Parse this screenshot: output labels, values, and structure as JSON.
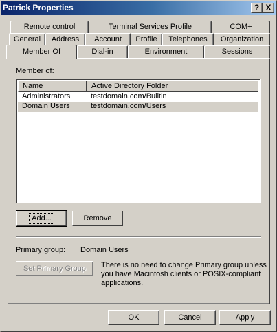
{
  "window": {
    "title": "Patrick Properties",
    "help_button": "?",
    "close_button": "X"
  },
  "tabs": {
    "row1": [
      "Remote control",
      "Terminal Services Profile",
      "COM+"
    ],
    "row2": [
      "General",
      "Address",
      "Account",
      "Profile",
      "Telephones",
      "Organization"
    ],
    "row3": [
      "Member Of",
      "Dial-in",
      "Environment",
      "Sessions"
    ],
    "selected": "Member Of"
  },
  "member_of": {
    "label": "Member of:",
    "columns": [
      "Name",
      "Active Directory Folder"
    ],
    "rows": [
      {
        "name": "Administrators",
        "folder": "testdomain.com/Builtin"
      },
      {
        "name": "Domain Users",
        "folder": "testdomain.com/Users"
      }
    ],
    "selected_row": "Domain Users"
  },
  "buttons": {
    "add": "Add...",
    "remove": "Remove",
    "set_primary_group": "Set Primary Group",
    "ok": "OK",
    "cancel": "Cancel",
    "apply": "Apply"
  },
  "primary_group": {
    "label": "Primary group:",
    "value": "Domain Users",
    "note_line1": "There is no need to change Primary group unless",
    "note_line2": "you have Macintosh clients or POSIX-compliant",
    "note_line3": "applications."
  }
}
